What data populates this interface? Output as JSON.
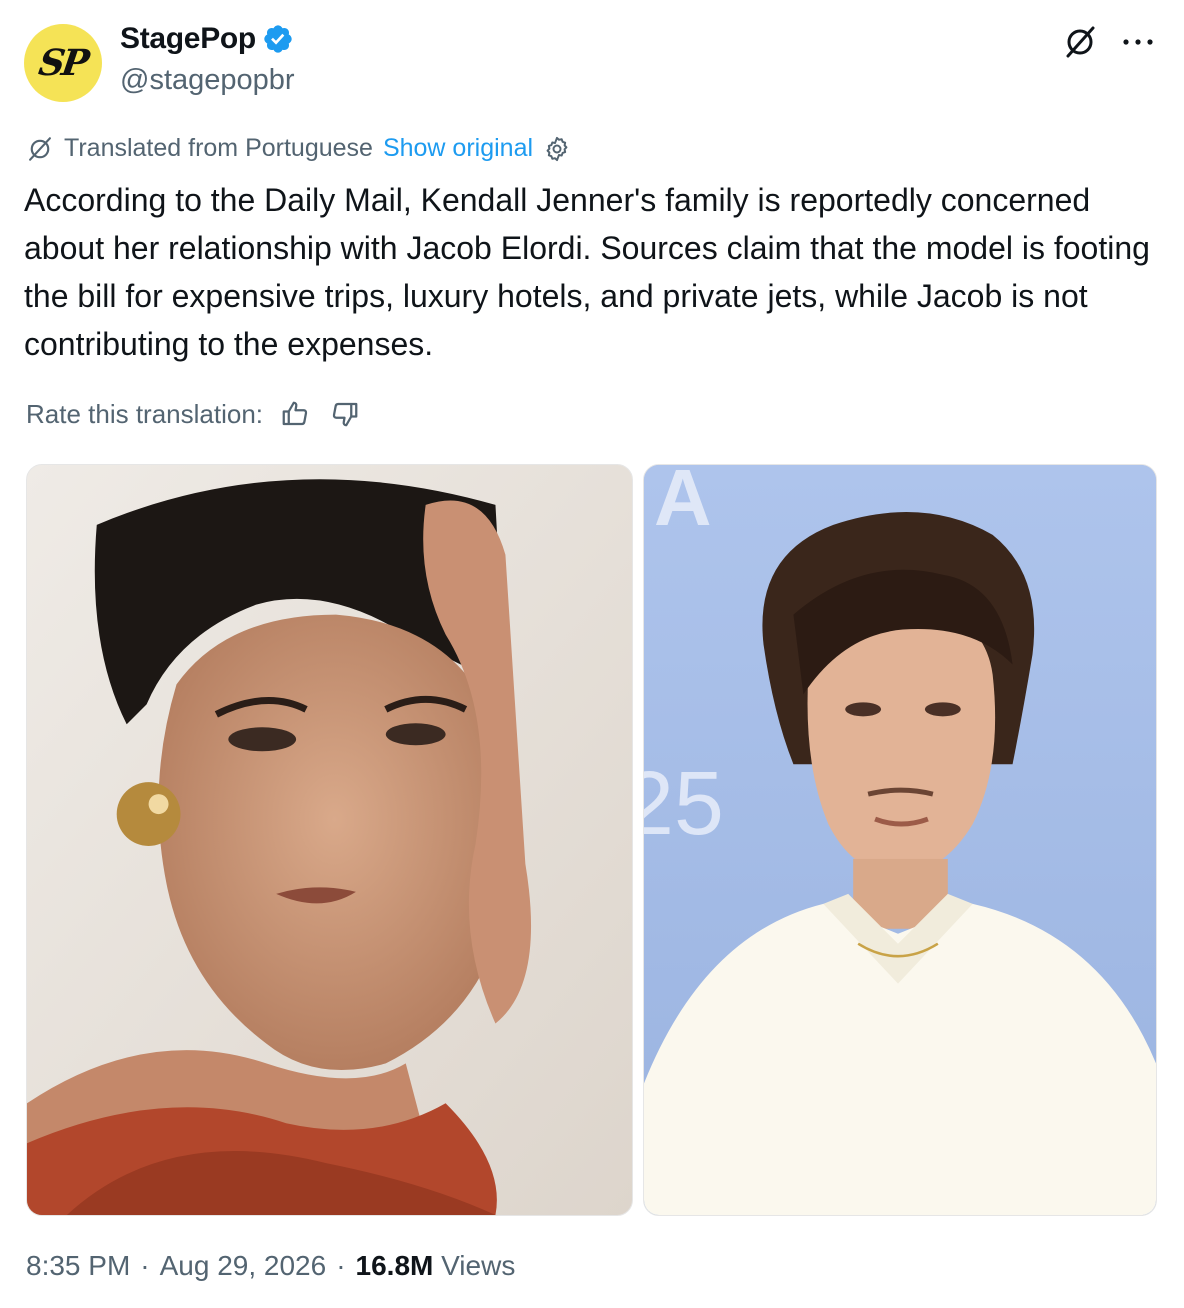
{
  "author": {
    "avatar_text": "SP",
    "display_name": "StagePop",
    "handle": "@stagepopbr",
    "verified": true,
    "avatar_color": "#f5e356"
  },
  "translation": {
    "translated_label": "Translated from Portuguese",
    "show_original": "Show original",
    "rate_label": "Rate this translation:"
  },
  "tweet": {
    "text": "According to the Daily Mail, Kendall Jenner's family is reportedly concerned about her relationship with Jacob Elordi. Sources claim that the model is footing the bill for expensive trips, luxury hotels, and private jets, while Jacob is not contributing to the expenses."
  },
  "media": {
    "right_photo_bg_text_top": "A",
    "right_photo_bg_text_mid": "25"
  },
  "meta": {
    "time": "8:35 PM",
    "separator": "·",
    "date": "Aug 29, 2026",
    "views_count": "16.8M",
    "views_label": "Views"
  },
  "colors": {
    "link": "#1d9bf0",
    "muted": "#536471",
    "text": "#0f1419",
    "verified": "#1d9bf0"
  },
  "icons": {
    "grok": "grok-icon",
    "more": "more-icon",
    "translate": "translate-icon",
    "settings": "gear-icon",
    "thumbs_up": "thumbs-up-icon",
    "thumbs_down": "thumbs-down-icon",
    "verified": "verified-badge-icon"
  }
}
